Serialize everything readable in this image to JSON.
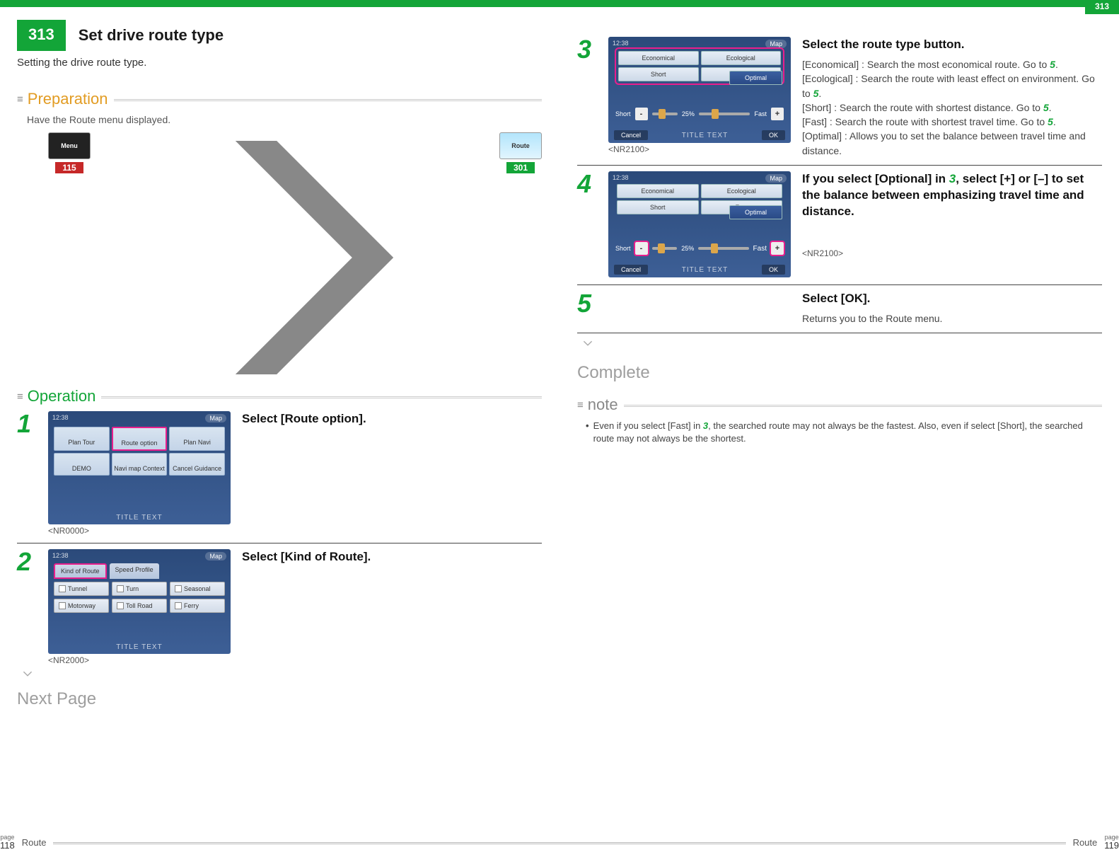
{
  "doc_number": "313",
  "top_tab": "313",
  "title": "Set drive route type",
  "subtitle": "Setting the drive route type.",
  "sections": {
    "preparation": "Preparation",
    "operation": "Operation",
    "note": "note"
  },
  "preparation": {
    "text": "Have the Route menu displayed.",
    "thumb1_label": "Menu",
    "thumb1_ref": "115",
    "thumb2_label": "Route",
    "thumb2_ref": "301"
  },
  "step1": {
    "num": "1",
    "heading": "Select [Route option].",
    "nr": "<NR0000>",
    "cells": [
      "Plan Tour",
      "Route option",
      "Plan Navi",
      "DEMO",
      "Navi map Context",
      "Cancel Guidance"
    ]
  },
  "step2": {
    "num": "2",
    "heading": "Select [Kind of Route].",
    "nr": "<NR2000>",
    "tabs": [
      "Kind of Route",
      "Speed Profile"
    ],
    "checks": [
      "Tunnel",
      "Turn",
      "Seasonal",
      "Motorway",
      "Toll Road",
      "Ferry"
    ]
  },
  "next_page": "Next Page",
  "step3": {
    "num": "3",
    "heading": "Select the route type button.",
    "nr": "<NR2100>",
    "rtabs": [
      "Economical",
      "Ecological",
      "Short",
      "Fast",
      "Optimal"
    ],
    "sl_left": "Short",
    "sl_pct": "25%",
    "sl_right": "Fast",
    "cancel": "Cancel",
    "ok": "OK",
    "lines": [
      {
        "pre": "[Economical] : Search the most economical route. Go to ",
        "goto": "5",
        "post": "."
      },
      {
        "pre": "[Ecological] : Search the route with least effect on environment. Go to ",
        "goto": "5",
        "post": "."
      },
      {
        "pre": "[Short] : Search the route with shortest distance. Go to ",
        "goto": "5",
        "post": "."
      },
      {
        "pre": "[Fast] : Search the route with shortest travel time. Go to ",
        "goto": "5",
        "post": "."
      },
      {
        "pre": "[Optimal] : Allows you to set the balance between travel time and distance.",
        "goto": "",
        "post": ""
      }
    ]
  },
  "step4": {
    "num": "4",
    "heading_pre": "If you select [Optional] in ",
    "heading_goto": "3",
    "heading_post": ", select [+] or [–] to set the balance between emphasizing travel time and distance.",
    "nr": "<NR2100>"
  },
  "step5": {
    "num": "5",
    "heading": "Select [OK].",
    "desc": "Returns you to the Route menu."
  },
  "complete": "Complete",
  "note": {
    "pre": "Even if you select [Fast] in ",
    "goto": "3",
    "post": ", the searched route may not always be the fastest. Also, even if select [Short], the searched route may not always be the shortest."
  },
  "footer": {
    "page_word": "page",
    "page_left": "118",
    "page_right": "119",
    "section": "Route"
  },
  "scr_common": {
    "time": "12:38",
    "map": "Map",
    "title": "TITLE TEXT"
  }
}
